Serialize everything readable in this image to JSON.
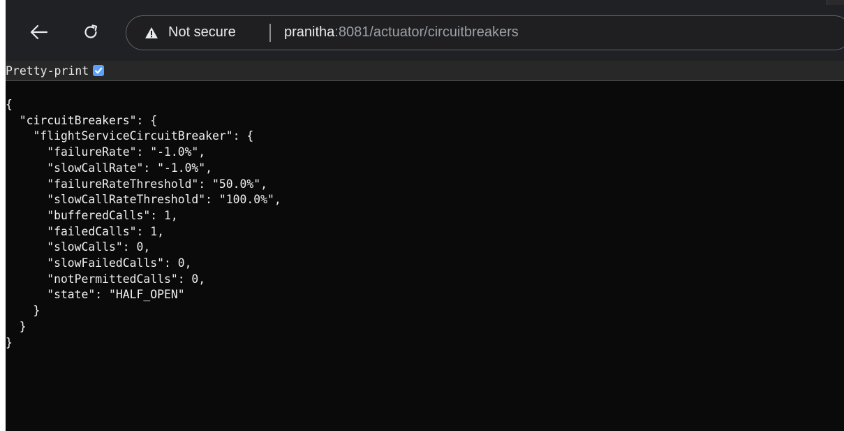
{
  "browser": {
    "security_label": "Not secure",
    "url_host": "pranitha",
    "url_rest": ":8081/actuator/circuitbreakers"
  },
  "icons": {
    "back": "back-arrow-icon",
    "reload": "reload-icon",
    "security": "warning-triangle-icon",
    "checkbox": "checkmark-icon"
  },
  "colors": {
    "toolbar_bg": "#202124",
    "content_bg": "#0a0a0a",
    "checkbox_accent": "#5aa0ff",
    "text": "#f0f0f0"
  },
  "viewer": {
    "pretty_print_label": "Pretty-print",
    "pretty_print_checked": true
  },
  "json_lines": [
    "{",
    "  \"circuitBreakers\": {",
    "    \"flightServiceCircuitBreaker\": {",
    "      \"failureRate\": \"-1.0%\",",
    "      \"slowCallRate\": \"-1.0%\",",
    "      \"failureRateThreshold\": \"50.0%\",",
    "      \"slowCallRateThreshold\": \"100.0%\",",
    "      \"bufferedCalls\": 1,",
    "      \"failedCalls\": 1,",
    "      \"slowCalls\": 0,",
    "      \"slowFailedCalls\": 0,",
    "      \"notPermittedCalls\": 0,",
    "      \"state\": \"HALF_OPEN\"",
    "    }",
    "  }",
    "}"
  ]
}
